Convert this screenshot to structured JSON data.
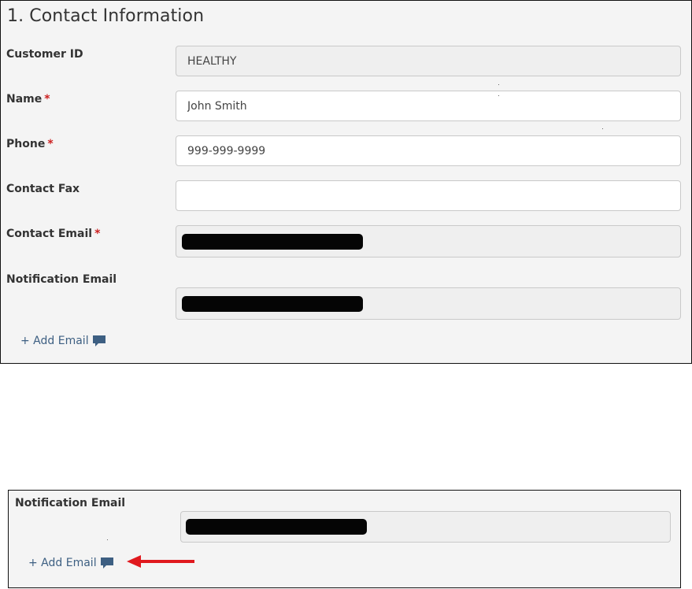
{
  "section": {
    "title": "1. Contact Information"
  },
  "fields": {
    "customer_id": {
      "label": "Customer ID",
      "value": "HEALTHY"
    },
    "name": {
      "label": "Name",
      "required_marker": "*",
      "value": "John Smith"
    },
    "phone": {
      "label": "Phone",
      "required_marker": "*",
      "value": "999-999-9999"
    },
    "contact_fax": {
      "label": "Contact Fax",
      "value": ""
    },
    "contact_email": {
      "label": "Contact Email",
      "required_marker": "*",
      "redacted": true
    },
    "notification_email": {
      "label": "Notification Email",
      "redacted": true
    }
  },
  "add_email": {
    "label": "+ Add Email",
    "icon": "comment-icon"
  },
  "zoom": {
    "notification_email_label": "Notification Email",
    "add_email_label": "+ Add Email",
    "arrow_color": "#e0191e"
  },
  "colors": {
    "required": "#cc1f1f",
    "link": "#3d5f82",
    "panel_bg": "#f4f4f4",
    "readonly_input_bg": "#efefef"
  }
}
